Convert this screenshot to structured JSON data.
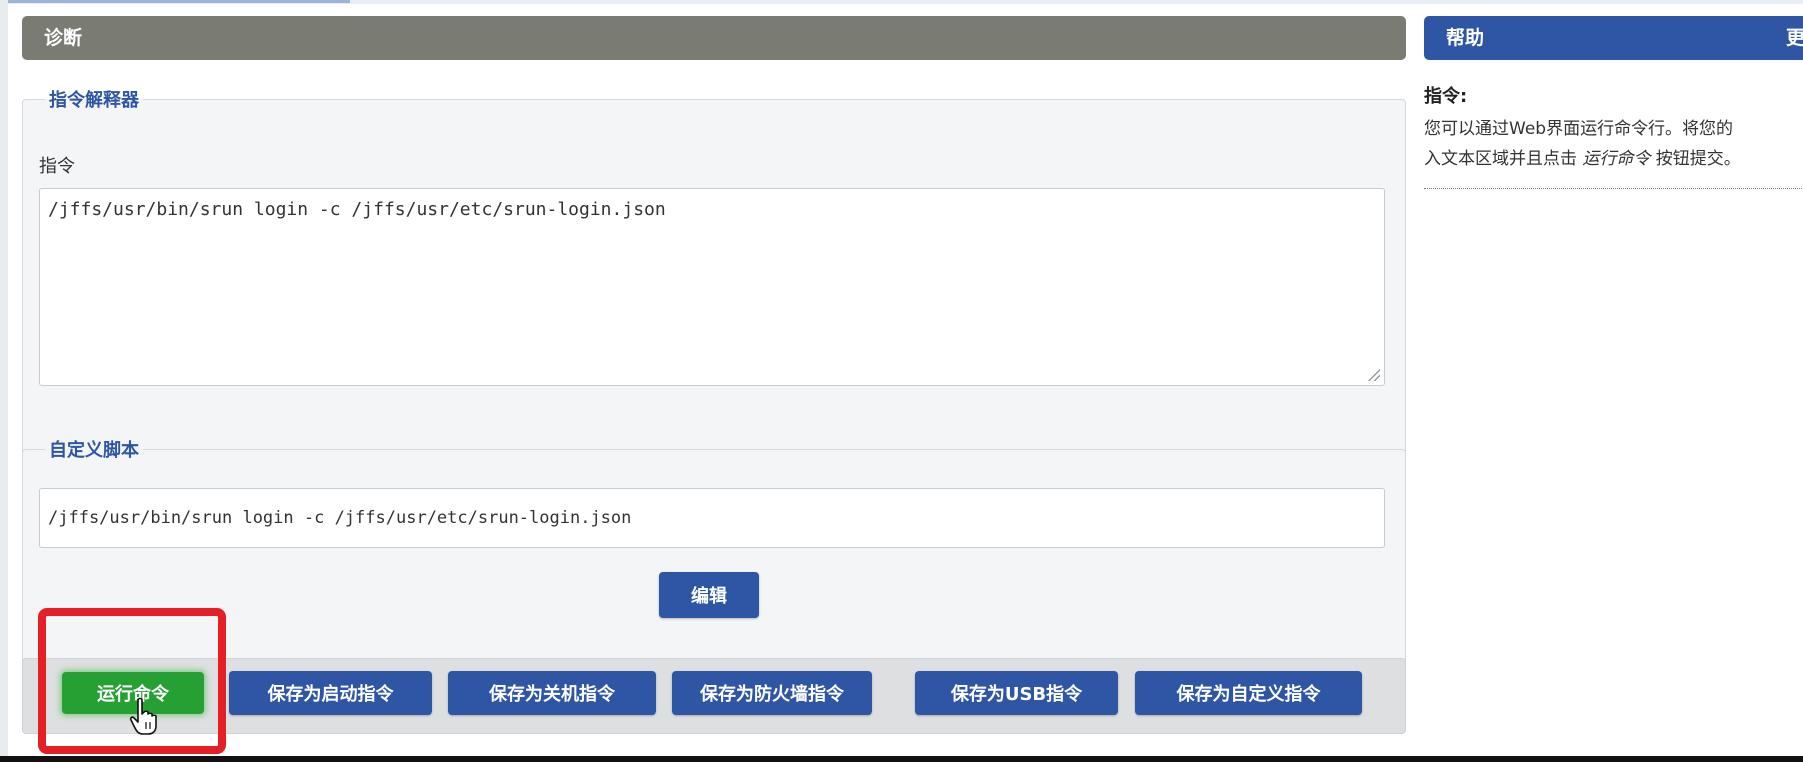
{
  "diagnostics": {
    "header": "诊断",
    "interpreter_legend": "指令解释器",
    "command_label": "指令",
    "command_value": "/jffs/usr/bin/srun login -c /jffs/usr/etc/srun-login.json",
    "custom_script_legend": "自定义脚本",
    "custom_script_value": "/jffs/usr/bin/srun login -c /jffs/usr/etc/srun-login.json",
    "edit_button": "编辑"
  },
  "actions": {
    "run": "运行命令",
    "save_startup": "保存为启动指令",
    "save_shutdown": "保存为关机指令",
    "save_firewall": "保存为防火墙指令",
    "save_usb": "保存为USB指令",
    "save_custom": "保存为自定义指令"
  },
  "help": {
    "header": "帮助",
    "more": "更",
    "title": "指令:",
    "line1": "您可以通过Web界面运行命令行。将您的",
    "line2_prefix": "入文本区域并且点击 ",
    "line2_emph": "运行命令",
    "line2_suffix": " 按钮提交。"
  },
  "colors": {
    "accent_blue": "#2e56a4",
    "run_green": "#26a033",
    "highlight_red": "#e51f26",
    "diag_header_gray": "#7a7b73"
  }
}
